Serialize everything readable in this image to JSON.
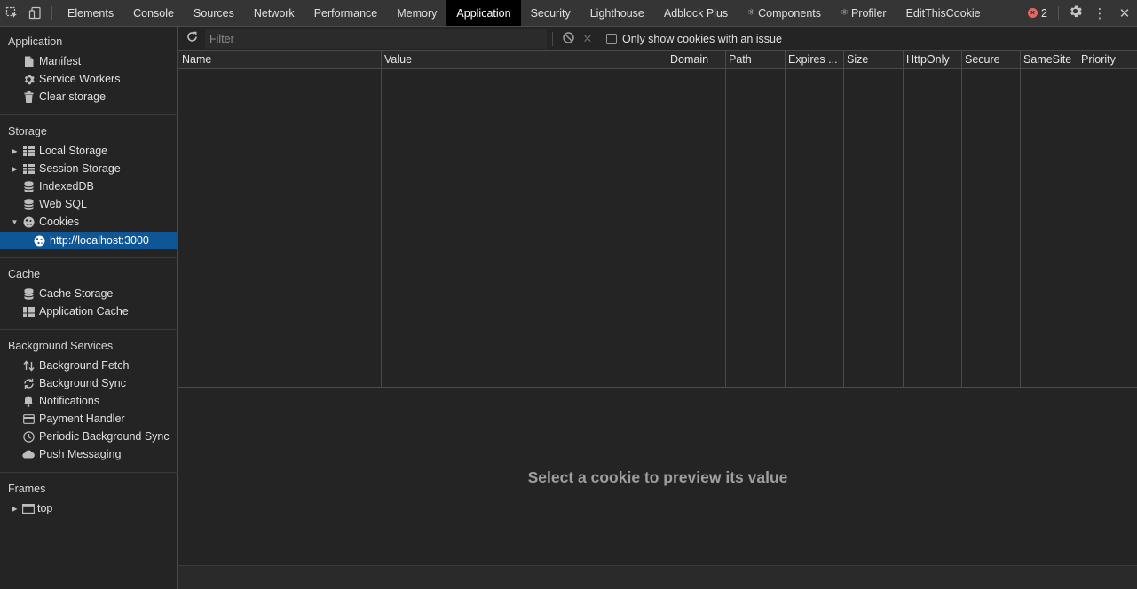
{
  "tabs": [
    {
      "label": "Elements",
      "active": false,
      "prefix": ""
    },
    {
      "label": "Console",
      "active": false,
      "prefix": ""
    },
    {
      "label": "Sources",
      "active": false,
      "prefix": ""
    },
    {
      "label": "Network",
      "active": false,
      "prefix": ""
    },
    {
      "label": "Performance",
      "active": false,
      "prefix": ""
    },
    {
      "label": "Memory",
      "active": false,
      "prefix": ""
    },
    {
      "label": "Application",
      "active": true,
      "prefix": ""
    },
    {
      "label": "Security",
      "active": false,
      "prefix": ""
    },
    {
      "label": "Lighthouse",
      "active": false,
      "prefix": ""
    },
    {
      "label": "Adblock Plus",
      "active": false,
      "prefix": ""
    },
    {
      "label": "Components",
      "active": false,
      "prefix": "⚛"
    },
    {
      "label": "Profiler",
      "active": false,
      "prefix": "⚛"
    },
    {
      "label": "EditThisCookie",
      "active": false,
      "prefix": ""
    }
  ],
  "error_count": "2",
  "sidebar": {
    "application": {
      "title": "Application",
      "items": [
        {
          "label": "Manifest",
          "icon": "file-icon"
        },
        {
          "label": "Service Workers",
          "icon": "gear-icon"
        },
        {
          "label": "Clear storage",
          "icon": "trash-icon"
        }
      ]
    },
    "storage": {
      "title": "Storage",
      "items": [
        {
          "label": "Local Storage",
          "icon": "grid-icon"
        },
        {
          "label": "Session Storage",
          "icon": "grid-icon"
        },
        {
          "label": "IndexedDB",
          "icon": "database-icon"
        },
        {
          "label": "Web SQL",
          "icon": "database-icon"
        },
        {
          "label": "Cookies",
          "icon": "cookie-icon"
        },
        {
          "label": "http://localhost:3000",
          "icon": "cookie-icon"
        }
      ]
    },
    "cache": {
      "title": "Cache",
      "items": [
        {
          "label": "Cache Storage",
          "icon": "database-icon"
        },
        {
          "label": "Application Cache",
          "icon": "grid-icon"
        }
      ]
    },
    "background_services": {
      "title": "Background Services",
      "items": [
        {
          "label": "Background Fetch",
          "icon": "up-down-arrows-icon"
        },
        {
          "label": "Background Sync",
          "icon": "sync-icon"
        },
        {
          "label": "Notifications",
          "icon": "bell-icon"
        },
        {
          "label": "Payment Handler",
          "icon": "credit-card-icon"
        },
        {
          "label": "Periodic Background Sync",
          "icon": "clock-icon"
        },
        {
          "label": "Push Messaging",
          "icon": "cloud-icon"
        }
      ]
    },
    "frames": {
      "title": "Frames",
      "items": [
        {
          "label": "top",
          "icon": "frame-icon"
        }
      ]
    }
  },
  "toolbar": {
    "filter_placeholder": "Filter",
    "checkbox_label": "Only show cookies with an issue",
    "checkbox_checked": false
  },
  "cookie_table": {
    "columns": [
      "Name",
      "Value",
      "Domain",
      "Path",
      "Expires ...",
      "Size",
      "HttpOnly",
      "Secure",
      "SameSite",
      "Priority"
    ],
    "rows": []
  },
  "preview": {
    "message": "Select a cookie to preview its value"
  },
  "colors": {
    "selected_bg": "#0f5697",
    "active_tab_bg": "#000000",
    "error_badge": "#e46962"
  }
}
